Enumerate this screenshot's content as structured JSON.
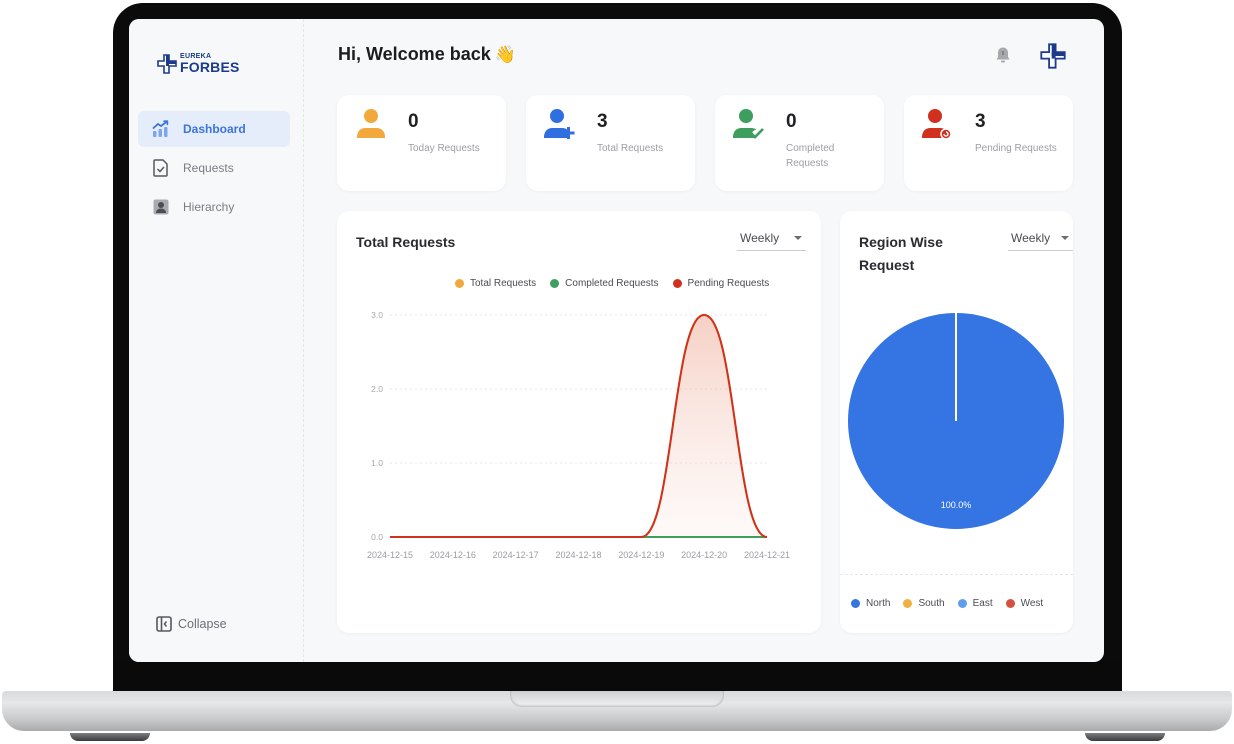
{
  "app": {
    "brand_line1": "EUREKA",
    "brand_line2": "FORBES",
    "brand_color": "#1b3a8c"
  },
  "sidebar": {
    "items": [
      {
        "label": "Dashboard",
        "icon": "trend-chart-icon",
        "active": true
      },
      {
        "label": "Requests",
        "icon": "document-check-icon",
        "active": false
      },
      {
        "label": "Hierarchy",
        "icon": "user-badge-icon",
        "active": false
      }
    ],
    "collapse_label": "Collapse"
  },
  "header": {
    "greeting": "Hi, Welcome back",
    "greeting_emoji": "👋",
    "bell_icon": "bell-icon",
    "brand_icon": "brand-cross-icon"
  },
  "stats": [
    {
      "value": "0",
      "label": "Today Requests",
      "color": "#f2a93b",
      "icon": "user-icon"
    },
    {
      "value": "3",
      "label": "Total Requests",
      "color": "#2f6fe0",
      "icon": "user-plus-icon"
    },
    {
      "value": "0",
      "label": "Completed Requests",
      "color": "#3d9e5f",
      "icon": "user-check-icon"
    },
    {
      "value": "3",
      "label": "Pending Requests",
      "color": "#d0311f",
      "icon": "user-pending-icon"
    }
  ],
  "requests_chart": {
    "title": "Total Requests",
    "period": "Weekly"
  },
  "region_chart": {
    "title_line1": "Region Wise",
    "title_line2": "Request",
    "period": "Weekly"
  },
  "chart_data": [
    {
      "type": "area",
      "title": "Total Requests",
      "xlabel": "",
      "ylabel": "",
      "x": [
        "2024-12-15",
        "2024-12-16",
        "2024-12-17",
        "2024-12-18",
        "2024-12-19",
        "2024-12-20",
        "2024-12-21"
      ],
      "ylim": [
        0,
        3
      ],
      "yticks": [
        "0.0",
        "1.0",
        "2.0",
        "3.0"
      ],
      "grid": true,
      "legend_position": "top-right",
      "series": [
        {
          "name": "Total Requests",
          "color": "#f2a93b",
          "values": [
            0,
            0,
            0,
            0,
            0,
            3,
            0
          ]
        },
        {
          "name": "Completed Requests",
          "color": "#3d9e5f",
          "values": [
            null,
            null,
            null,
            null,
            0,
            0,
            0
          ]
        },
        {
          "name": "Pending Requests",
          "color": "#d0311f",
          "values": [
            0,
            0,
            0,
            0,
            0,
            3,
            0
          ]
        }
      ]
    },
    {
      "type": "pie",
      "title": "Region Wise Request",
      "legend_position": "bottom",
      "categories": [
        "North",
        "South",
        "East",
        "West"
      ],
      "colors": [
        "#3574e3",
        "#f2b03f",
        "#5f9ded",
        "#d4503f"
      ],
      "values": [
        100,
        0,
        0,
        0
      ],
      "labels": [
        "100.0%",
        "",
        "",
        ""
      ]
    }
  ]
}
